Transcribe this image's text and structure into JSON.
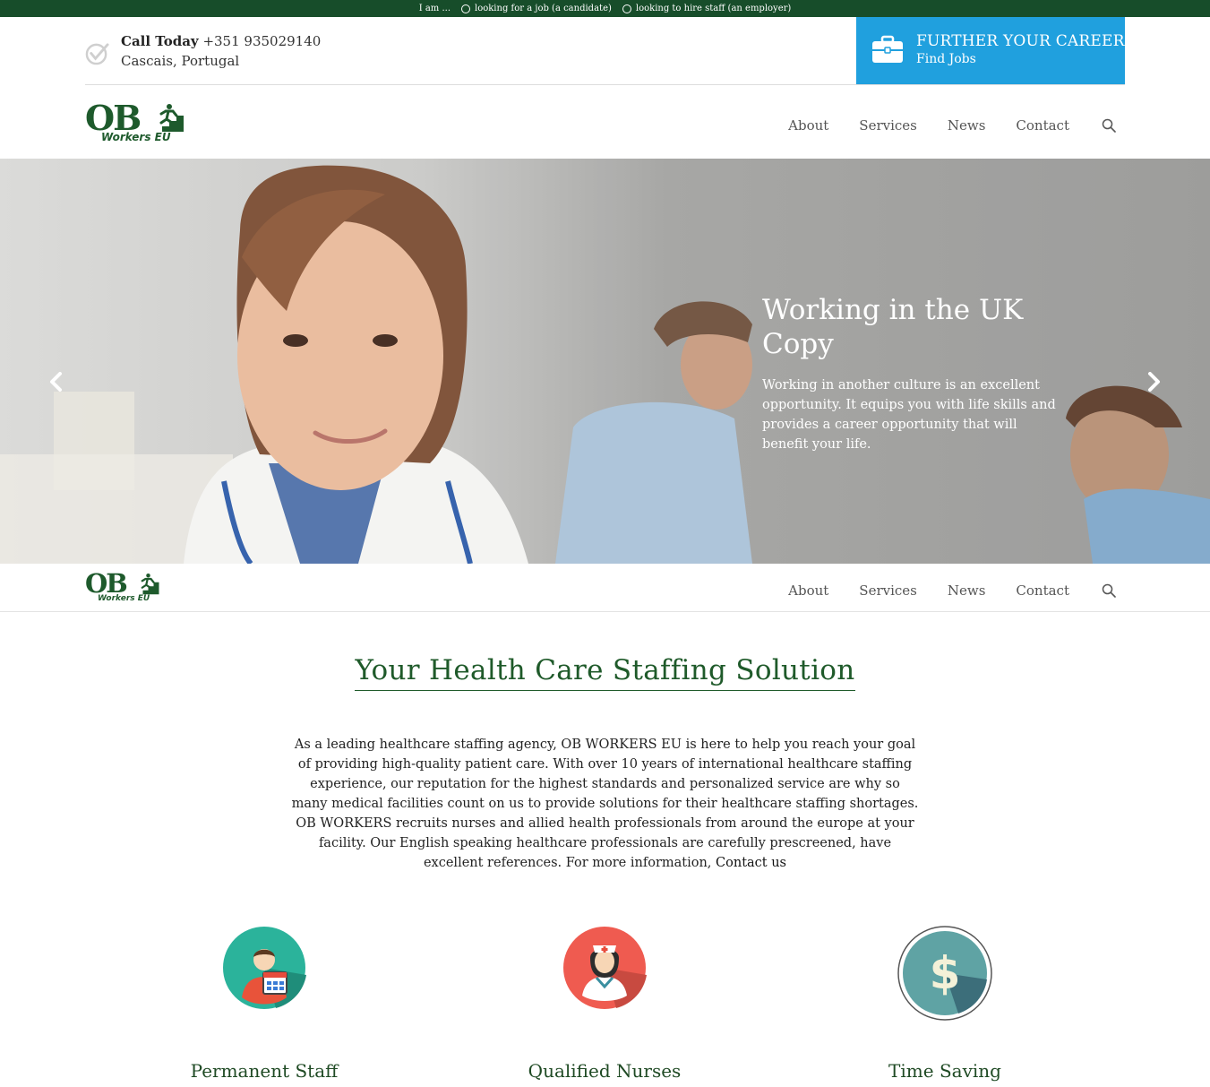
{
  "topbar": {
    "prefix": "I am ...",
    "option_candidate": "looking for a job (a candidate)",
    "option_employer": "looking to hire staff (an employer)"
  },
  "contact": {
    "call_label": "Call Today",
    "phone": "+351 935029140",
    "location": "Cascais, Portugal"
  },
  "career_cta": {
    "title": "FURTHER YOUR CAREER",
    "subtitle": "Find Jobs"
  },
  "logo": {
    "main": "OB",
    "sub": "Workers EU"
  },
  "nav": {
    "items": [
      "About",
      "Services",
      "News",
      "Contact"
    ]
  },
  "hero": {
    "title": "Working in the UK Copy",
    "text": "Working in another culture is an excellent opportunity. It equips you with life skills and provides a career opportunity that will benefit your life."
  },
  "intro": {
    "title": "Your Health Care Staffing Solution",
    "body": "As a leading healthcare staffing agency, OB WORKERS EU is here to help you reach your goal of providing high-quality patient care. With over 10 years of international healthcare staffing experience, our reputation for the highest standards and personalized service are why so many medical facilities count on us to provide solutions for their healthcare staffing shortages. OB WORKERS recruits nurses and allied health professionals from around the europe at your facility. Our English speaking healthcare professionals are carefully prescreened, have excellent references. For more information,",
    "link": "Contact us"
  },
  "features": [
    {
      "title": "Permanent Staff",
      "icon": "staff-calendar-icon",
      "color": "#2bb39b"
    },
    {
      "title": "Qualified Nurses",
      "icon": "nurse-icon",
      "color": "#ef5b50"
    },
    {
      "title": "Time Saving",
      "icon": "dollar-icon",
      "color": "#5fa3a4"
    }
  ],
  "colors": {
    "brand_green": "#174d2a",
    "cta_blue": "#20a0de"
  }
}
